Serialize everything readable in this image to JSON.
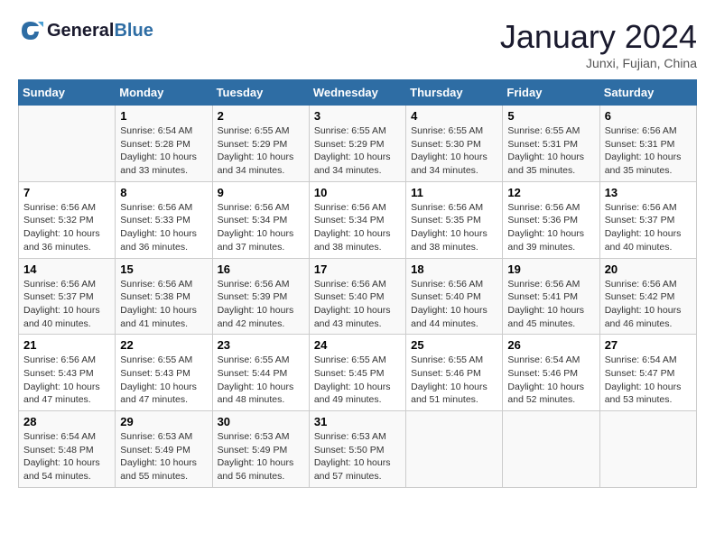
{
  "header": {
    "logo_general": "General",
    "logo_blue": "Blue",
    "month": "January 2024",
    "location": "Junxi, Fujian, China"
  },
  "days_of_week": [
    "Sunday",
    "Monday",
    "Tuesday",
    "Wednesday",
    "Thursday",
    "Friday",
    "Saturday"
  ],
  "weeks": [
    [
      {
        "day": null,
        "sunrise": null,
        "sunset": null,
        "daylight": null
      },
      {
        "day": "1",
        "sunrise": "Sunrise: 6:54 AM",
        "sunset": "Sunset: 5:28 PM",
        "daylight": "Daylight: 10 hours and 33 minutes."
      },
      {
        "day": "2",
        "sunrise": "Sunrise: 6:55 AM",
        "sunset": "Sunset: 5:29 PM",
        "daylight": "Daylight: 10 hours and 34 minutes."
      },
      {
        "day": "3",
        "sunrise": "Sunrise: 6:55 AM",
        "sunset": "Sunset: 5:29 PM",
        "daylight": "Daylight: 10 hours and 34 minutes."
      },
      {
        "day": "4",
        "sunrise": "Sunrise: 6:55 AM",
        "sunset": "Sunset: 5:30 PM",
        "daylight": "Daylight: 10 hours and 34 minutes."
      },
      {
        "day": "5",
        "sunrise": "Sunrise: 6:55 AM",
        "sunset": "Sunset: 5:31 PM",
        "daylight": "Daylight: 10 hours and 35 minutes."
      },
      {
        "day": "6",
        "sunrise": "Sunrise: 6:56 AM",
        "sunset": "Sunset: 5:31 PM",
        "daylight": "Daylight: 10 hours and 35 minutes."
      }
    ],
    [
      {
        "day": "7",
        "sunrise": "Sunrise: 6:56 AM",
        "sunset": "Sunset: 5:32 PM",
        "daylight": "Daylight: 10 hours and 36 minutes."
      },
      {
        "day": "8",
        "sunrise": "Sunrise: 6:56 AM",
        "sunset": "Sunset: 5:33 PM",
        "daylight": "Daylight: 10 hours and 36 minutes."
      },
      {
        "day": "9",
        "sunrise": "Sunrise: 6:56 AM",
        "sunset": "Sunset: 5:34 PM",
        "daylight": "Daylight: 10 hours and 37 minutes."
      },
      {
        "day": "10",
        "sunrise": "Sunrise: 6:56 AM",
        "sunset": "Sunset: 5:34 PM",
        "daylight": "Daylight: 10 hours and 38 minutes."
      },
      {
        "day": "11",
        "sunrise": "Sunrise: 6:56 AM",
        "sunset": "Sunset: 5:35 PM",
        "daylight": "Daylight: 10 hours and 38 minutes."
      },
      {
        "day": "12",
        "sunrise": "Sunrise: 6:56 AM",
        "sunset": "Sunset: 5:36 PM",
        "daylight": "Daylight: 10 hours and 39 minutes."
      },
      {
        "day": "13",
        "sunrise": "Sunrise: 6:56 AM",
        "sunset": "Sunset: 5:37 PM",
        "daylight": "Daylight: 10 hours and 40 minutes."
      }
    ],
    [
      {
        "day": "14",
        "sunrise": "Sunrise: 6:56 AM",
        "sunset": "Sunset: 5:37 PM",
        "daylight": "Daylight: 10 hours and 40 minutes."
      },
      {
        "day": "15",
        "sunrise": "Sunrise: 6:56 AM",
        "sunset": "Sunset: 5:38 PM",
        "daylight": "Daylight: 10 hours and 41 minutes."
      },
      {
        "day": "16",
        "sunrise": "Sunrise: 6:56 AM",
        "sunset": "Sunset: 5:39 PM",
        "daylight": "Daylight: 10 hours and 42 minutes."
      },
      {
        "day": "17",
        "sunrise": "Sunrise: 6:56 AM",
        "sunset": "Sunset: 5:40 PM",
        "daylight": "Daylight: 10 hours and 43 minutes."
      },
      {
        "day": "18",
        "sunrise": "Sunrise: 6:56 AM",
        "sunset": "Sunset: 5:40 PM",
        "daylight": "Daylight: 10 hours and 44 minutes."
      },
      {
        "day": "19",
        "sunrise": "Sunrise: 6:56 AM",
        "sunset": "Sunset: 5:41 PM",
        "daylight": "Daylight: 10 hours and 45 minutes."
      },
      {
        "day": "20",
        "sunrise": "Sunrise: 6:56 AM",
        "sunset": "Sunset: 5:42 PM",
        "daylight": "Daylight: 10 hours and 46 minutes."
      }
    ],
    [
      {
        "day": "21",
        "sunrise": "Sunrise: 6:56 AM",
        "sunset": "Sunset: 5:43 PM",
        "daylight": "Daylight: 10 hours and 47 minutes."
      },
      {
        "day": "22",
        "sunrise": "Sunrise: 6:55 AM",
        "sunset": "Sunset: 5:43 PM",
        "daylight": "Daylight: 10 hours and 47 minutes."
      },
      {
        "day": "23",
        "sunrise": "Sunrise: 6:55 AM",
        "sunset": "Sunset: 5:44 PM",
        "daylight": "Daylight: 10 hours and 48 minutes."
      },
      {
        "day": "24",
        "sunrise": "Sunrise: 6:55 AM",
        "sunset": "Sunset: 5:45 PM",
        "daylight": "Daylight: 10 hours and 49 minutes."
      },
      {
        "day": "25",
        "sunrise": "Sunrise: 6:55 AM",
        "sunset": "Sunset: 5:46 PM",
        "daylight": "Daylight: 10 hours and 51 minutes."
      },
      {
        "day": "26",
        "sunrise": "Sunrise: 6:54 AM",
        "sunset": "Sunset: 5:46 PM",
        "daylight": "Daylight: 10 hours and 52 minutes."
      },
      {
        "day": "27",
        "sunrise": "Sunrise: 6:54 AM",
        "sunset": "Sunset: 5:47 PM",
        "daylight": "Daylight: 10 hours and 53 minutes."
      }
    ],
    [
      {
        "day": "28",
        "sunrise": "Sunrise: 6:54 AM",
        "sunset": "Sunset: 5:48 PM",
        "daylight": "Daylight: 10 hours and 54 minutes."
      },
      {
        "day": "29",
        "sunrise": "Sunrise: 6:53 AM",
        "sunset": "Sunset: 5:49 PM",
        "daylight": "Daylight: 10 hours and 55 minutes."
      },
      {
        "day": "30",
        "sunrise": "Sunrise: 6:53 AM",
        "sunset": "Sunset: 5:49 PM",
        "daylight": "Daylight: 10 hours and 56 minutes."
      },
      {
        "day": "31",
        "sunrise": "Sunrise: 6:53 AM",
        "sunset": "Sunset: 5:50 PM",
        "daylight": "Daylight: 10 hours and 57 minutes."
      },
      {
        "day": null,
        "sunrise": null,
        "sunset": null,
        "daylight": null
      },
      {
        "day": null,
        "sunrise": null,
        "sunset": null,
        "daylight": null
      },
      {
        "day": null,
        "sunrise": null,
        "sunset": null,
        "daylight": null
      }
    ]
  ]
}
